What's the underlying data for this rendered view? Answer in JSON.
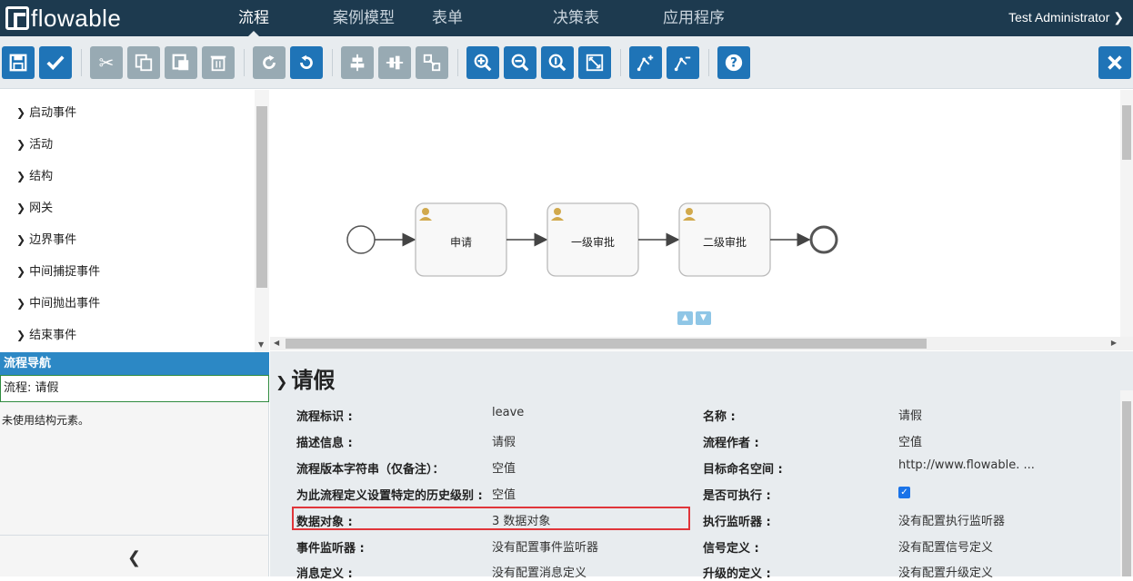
{
  "app": {
    "logo_text": "flowable",
    "user": "Test Administrator"
  },
  "nav": {
    "items": [
      "流程",
      "案例模型",
      "表单",
      "决策表",
      "应用程序"
    ]
  },
  "palette": {
    "items": [
      "启动事件",
      "活动",
      "结构",
      "网关",
      "边界事件",
      "中间捕捉事件",
      "中间抛出事件",
      "结束事件"
    ]
  },
  "navigator": {
    "title": "流程导航",
    "process": "流程: 请假",
    "empty": "未使用结构元素。"
  },
  "diagram": {
    "tasks": [
      "申请",
      "一级审批",
      "二级审批"
    ]
  },
  "properties": {
    "title": "请假",
    "rows": [
      {
        "label": "流程标识 :",
        "value": "leave"
      },
      {
        "label": "名称 :",
        "value": "请假"
      },
      {
        "label": "描述信息 :",
        "value": "请假"
      },
      {
        "label": "流程作者 :",
        "value": "空值"
      },
      {
        "label": "流程版本字符串（仅备注）：",
        "value": "空值"
      },
      {
        "label": "目标命名空间 :",
        "value": "http://www.flowable. ..."
      },
      {
        "label": "为此流程定义设置特定的历史级别 :",
        "value": "空值"
      },
      {
        "label": "是否可执行 :",
        "value": ""
      },
      {
        "label": "数据对象 :",
        "value": "3 数据对象"
      },
      {
        "label": "执行监听器 :",
        "value": "没有配置执行监听器"
      },
      {
        "label": "事件监听器 :",
        "value": "没有配置事件监听器"
      },
      {
        "label": "信号定义 :",
        "value": "没有配置信号定义"
      },
      {
        "label": "消息定义 :",
        "value": "没有配置消息定义"
      },
      {
        "label": "升级的定义 :",
        "value": "没有配置升级定义"
      }
    ]
  },
  "colors": {
    "nav_bg": "#1d3a4f",
    "accent": "#1f74b7",
    "highlight": "#e0353a"
  }
}
